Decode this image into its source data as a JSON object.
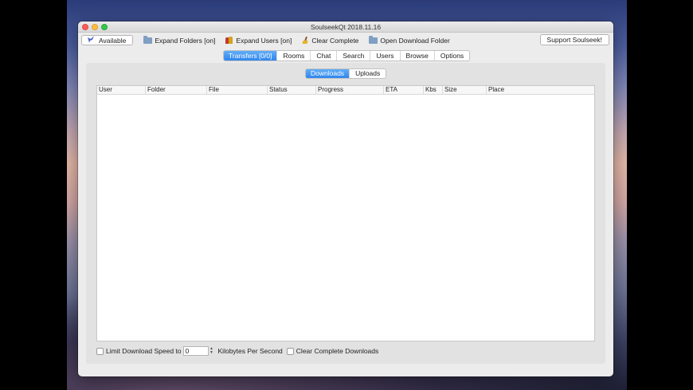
{
  "window": {
    "title": "SoulseekQt 2018.11.16"
  },
  "toolbar": {
    "status_label": "Available",
    "expand_folders": "Expand Folders [on]",
    "expand_users": "Expand Users [on]",
    "clear_complete": "Clear Complete",
    "open_download_folder": "Open Download Folder",
    "support": "Support Soulseek!"
  },
  "main_tabs": [
    "Transfers [0/0]",
    "Rooms",
    "Chat",
    "Search",
    "Users",
    "Browse",
    "Options"
  ],
  "sub_tabs": [
    "Downloads",
    "Uploads"
  ],
  "table": {
    "columns": [
      "User",
      "Folder",
      "File",
      "Status",
      "Progress",
      "ETA",
      "Kbs",
      "Size",
      "Place"
    ]
  },
  "bottom": {
    "limit_label": "Limit Download Speed to",
    "limit_value": "0",
    "unit_label": "Kilobytes Per Second",
    "clear_complete_downloads": "Clear Complete Downloads"
  },
  "icons": {
    "status": "bird-icon",
    "expand_folders": "folder-icon",
    "expand_users": "users-icon",
    "clear_complete": "broom-icon",
    "open_download_folder": "folder-icon"
  },
  "colors": {
    "accent": "#2f85ee"
  }
}
